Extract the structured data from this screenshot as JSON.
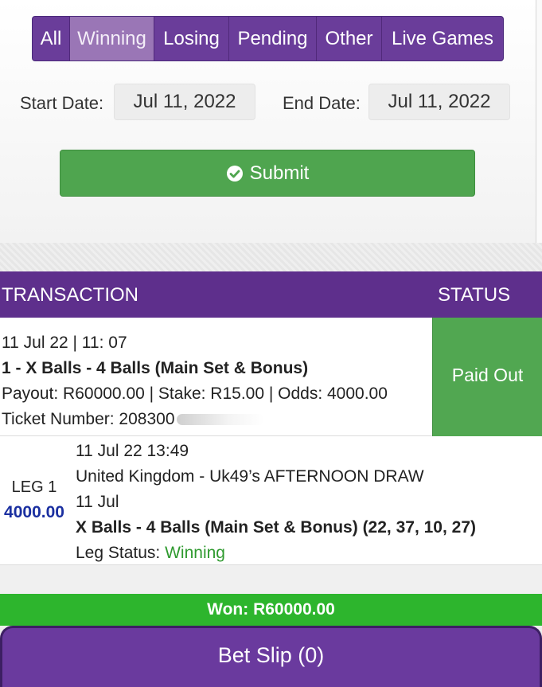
{
  "tabs": [
    {
      "label": "All",
      "active": false
    },
    {
      "label": "Winning",
      "active": true
    },
    {
      "label": "Losing",
      "active": false
    },
    {
      "label": "Pending",
      "active": false
    },
    {
      "label": "Other",
      "active": false
    },
    {
      "label": "Live Games",
      "active": false
    }
  ],
  "filters": {
    "start_label": "Start Date:",
    "start_value": "Jul 11, 2022",
    "end_label": "End Date:",
    "end_value": "Jul 11, 2022",
    "submit_label": "Submit",
    "submit_icon": "check-circle-icon"
  },
  "table": {
    "col_transaction": "TRANSACTION",
    "col_status": "STATUS"
  },
  "transaction": {
    "datetime": "11 Jul 22 | 11: 07",
    "title": "1 - X Balls - 4 Balls (Main Set & Bonus)",
    "summary": "Payout: R60000.00 | Stake: R15.00 | Odds: 4000.00",
    "ticket_label": "Ticket Number: 208300",
    "status": "Paid Out"
  },
  "leg": {
    "label": "LEG 1",
    "odds": "4000.00",
    "datetime": "11 Jul 22 13:49",
    "event": "United Kingdom - Uk49’s AFTERNOON DRAW",
    "date": "11 Jul",
    "selection": "X Balls - 4 Balls (Main Set & Bonus) (22, 37, 10, 27)",
    "status_label": "Leg Status:",
    "status_value": "Winning"
  },
  "won_text": "Won: R60000.00",
  "bet_slip_label": "Bet Slip (0)",
  "colors": {
    "purple": "#5e2f8c",
    "green": "#51a751",
    "won_green": "#2db52d",
    "odds_blue": "#1a2fa0"
  }
}
